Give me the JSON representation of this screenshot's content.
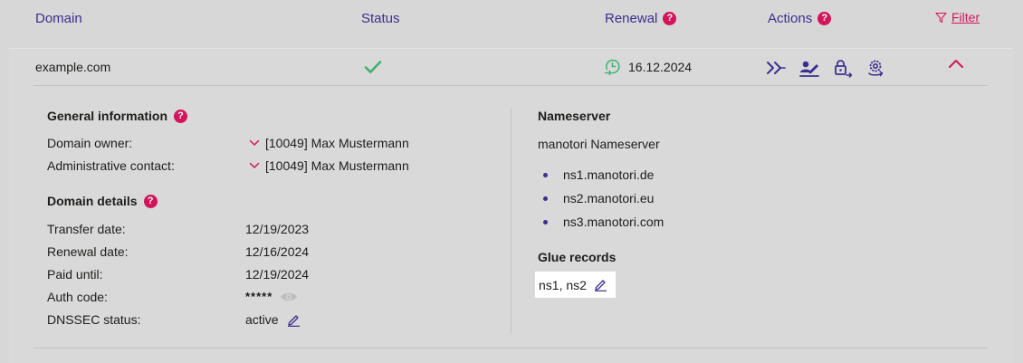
{
  "header": {
    "domain_col": "Domain",
    "status_col": "Status",
    "renewal_col": "Renewal",
    "actions_col": "Actions",
    "filter_label": "Filter"
  },
  "row": {
    "domain": "example.com",
    "status_icon": "check-icon",
    "renewal_date": "16.12.2024"
  },
  "general": {
    "title": "General information",
    "owner_label": "Domain owner:",
    "owner_value": "[10049] Max Mustermann",
    "admin_label": "Administrative contact:",
    "admin_value": "[10049] Max Mustermann"
  },
  "details": {
    "title": "Domain details",
    "transfer_label": "Transfer date:",
    "transfer_value": "12/19/2023",
    "renewal_label": "Renewal date:",
    "renewal_value": "12/16/2024",
    "paid_label": "Paid until:",
    "paid_value": "12/19/2024",
    "auth_label": "Auth code:",
    "auth_value": "*****",
    "dnssec_label": "DNSSEC status:",
    "dnssec_value": "active"
  },
  "nameserver": {
    "title": "Nameserver",
    "provider": "manotori Nameserver",
    "servers": [
      "ns1.manotori.de",
      "ns2.manotori.eu",
      "ns3.manotori.com"
    ]
  },
  "glue": {
    "title": "Glue records",
    "value": "ns1, ns2"
  },
  "colors": {
    "accent": "#3b2f8f",
    "help": "#d4145a",
    "success": "#3cb371"
  }
}
